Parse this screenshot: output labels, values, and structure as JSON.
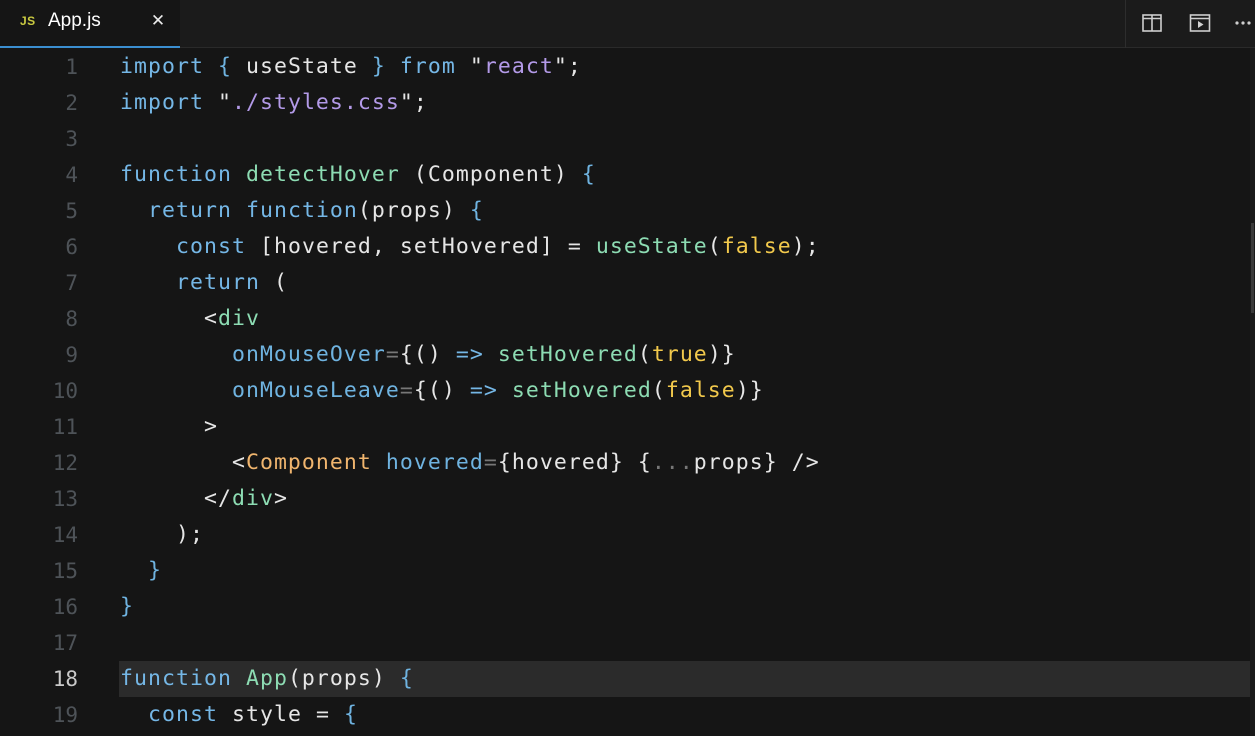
{
  "tab": {
    "icon_label": "JS",
    "title": "App.js",
    "close_glyph": "✕"
  },
  "toolbar": {
    "split_editor_icon": "split-editor-icon",
    "preview_icon": "preview-icon",
    "more_icon": "more-actions-icon"
  },
  "editor": {
    "active_line": 18,
    "lines": [
      {
        "n": "1",
        "tokens": [
          [
            "kw",
            "import"
          ],
          [
            "pl",
            " "
          ],
          [
            "br",
            "{"
          ],
          [
            "pl",
            " useState "
          ],
          [
            "br",
            "}"
          ],
          [
            "pl",
            " "
          ],
          [
            "kw",
            "from"
          ],
          [
            "pl",
            " \""
          ],
          [
            "str",
            "react"
          ],
          [
            "pl",
            "\";"
          ]
        ]
      },
      {
        "n": "2",
        "tokens": [
          [
            "kw",
            "import"
          ],
          [
            "pl",
            " \""
          ],
          [
            "str",
            "./styles.css"
          ],
          [
            "pl",
            "\";"
          ]
        ]
      },
      {
        "n": "3",
        "tokens": []
      },
      {
        "n": "4",
        "tokens": [
          [
            "kw",
            "function"
          ],
          [
            "pl",
            " "
          ],
          [
            "fn",
            "detectHover"
          ],
          [
            "pl",
            " (Component) "
          ],
          [
            "br",
            "{"
          ]
        ]
      },
      {
        "n": "5",
        "tokens": [
          [
            "pl",
            "  "
          ],
          [
            "kw",
            "return"
          ],
          [
            "pl",
            " "
          ],
          [
            "kw",
            "function"
          ],
          [
            "pl",
            "(props) "
          ],
          [
            "br",
            "{"
          ]
        ]
      },
      {
        "n": "6",
        "tokens": [
          [
            "pl",
            "    "
          ],
          [
            "kw",
            "const"
          ],
          [
            "pl",
            " [hovered, setHovered] = "
          ],
          [
            "fn",
            "useState"
          ],
          [
            "pl",
            "("
          ],
          [
            "bool",
            "false"
          ],
          [
            "pl",
            ");"
          ]
        ]
      },
      {
        "n": "7",
        "tokens": [
          [
            "pl",
            "    "
          ],
          [
            "kw",
            "return"
          ],
          [
            "pl",
            " ("
          ]
        ]
      },
      {
        "n": "8",
        "tokens": [
          [
            "pl",
            "      <"
          ],
          [
            "tag",
            "div"
          ]
        ]
      },
      {
        "n": "9",
        "tokens": [
          [
            "pl",
            "        "
          ],
          [
            "attr",
            "onMouseOver"
          ],
          [
            "dim",
            "="
          ],
          [
            "pl",
            "{() "
          ],
          [
            "kw",
            "=>"
          ],
          [
            "pl",
            " "
          ],
          [
            "fn",
            "setHovered"
          ],
          [
            "pl",
            "("
          ],
          [
            "bool",
            "true"
          ],
          [
            "pl",
            ")}"
          ]
        ]
      },
      {
        "n": "10",
        "tokens": [
          [
            "pl",
            "        "
          ],
          [
            "attr",
            "onMouseLeave"
          ],
          [
            "dim",
            "="
          ],
          [
            "pl",
            "{() "
          ],
          [
            "kw",
            "=>"
          ],
          [
            "pl",
            " "
          ],
          [
            "fn",
            "setHovered"
          ],
          [
            "pl",
            "("
          ],
          [
            "bool",
            "false"
          ],
          [
            "pl",
            ")}"
          ]
        ]
      },
      {
        "n": "11",
        "tokens": [
          [
            "pl",
            "      >"
          ]
        ]
      },
      {
        "n": "12",
        "tokens": [
          [
            "pl",
            "        <"
          ],
          [
            "jsx",
            "Component"
          ],
          [
            "pl",
            " "
          ],
          [
            "attr",
            "hovered"
          ],
          [
            "dim",
            "="
          ],
          [
            "pl",
            "{hovered} {"
          ],
          [
            "dim",
            "..."
          ],
          [
            "pl",
            "props} />"
          ]
        ]
      },
      {
        "n": "13",
        "tokens": [
          [
            "pl",
            "      </"
          ],
          [
            "tag",
            "div"
          ],
          [
            "pl",
            ">"
          ]
        ]
      },
      {
        "n": "14",
        "tokens": [
          [
            "pl",
            "    );"
          ]
        ]
      },
      {
        "n": "15",
        "tokens": [
          [
            "pl",
            "  "
          ],
          [
            "br",
            "}"
          ]
        ]
      },
      {
        "n": "16",
        "tokens": [
          [
            "br",
            "}"
          ]
        ]
      },
      {
        "n": "17",
        "tokens": []
      },
      {
        "n": "18",
        "tokens": [
          [
            "kw",
            "function"
          ],
          [
            "pl",
            " "
          ],
          [
            "fn",
            "App"
          ],
          [
            "pl",
            "(props) "
          ],
          [
            "br",
            "{"
          ]
        ]
      },
      {
        "n": "19",
        "tokens": [
          [
            "pl",
            "  "
          ],
          [
            "kw",
            "const"
          ],
          [
            "pl",
            " style = "
          ],
          [
            "br",
            "{"
          ]
        ]
      }
    ]
  }
}
